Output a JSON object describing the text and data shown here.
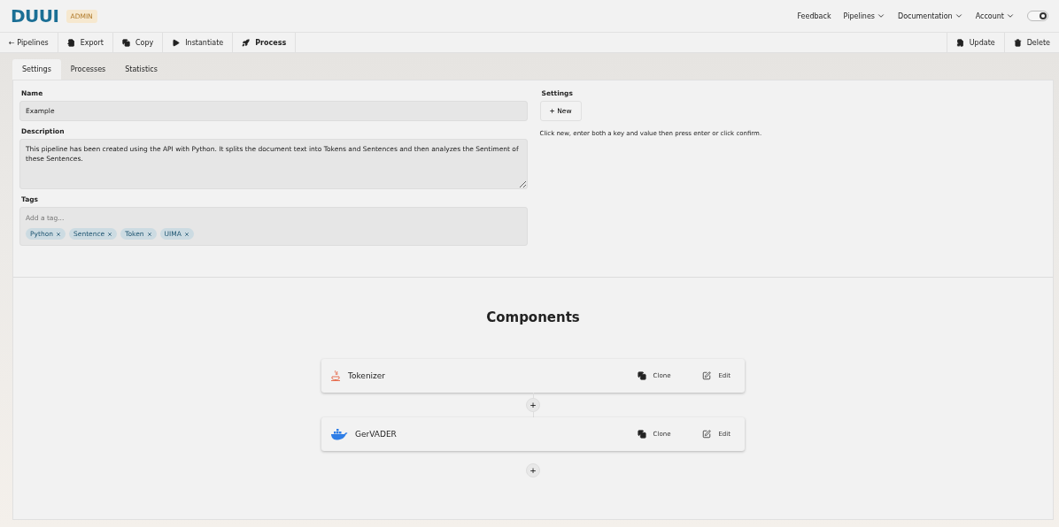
{
  "header": {
    "logo": "DUUI",
    "badge": "ADMIN",
    "nav": [
      {
        "label": "Feedback",
        "dropdown": false
      },
      {
        "label": "Pipelines",
        "dropdown": true
      },
      {
        "label": "Documentation",
        "dropdown": true
      },
      {
        "label": "Account",
        "dropdown": true
      }
    ],
    "theme_toggle": {
      "on": true
    }
  },
  "toolbar": {
    "left": [
      {
        "label": "← Pipelines",
        "bold": false
      },
      {
        "label": "Export",
        "bold": false
      },
      {
        "label": "Copy",
        "bold": false
      },
      {
        "label": "Instantiate",
        "bold": false
      },
      {
        "label": "Process",
        "bold": true
      }
    ],
    "right": [
      {
        "label": "Update"
      },
      {
        "label": "Delete"
      }
    ]
  },
  "tabs": [
    {
      "label": "Settings",
      "selected": true
    },
    {
      "label": "Processes",
      "selected": false
    },
    {
      "label": "Statistics",
      "selected": false
    }
  ],
  "form": {
    "name_label": "Name",
    "name_value": "Example",
    "description_label": "Description",
    "description_value": "This pipeline has been created using the API with Python. It splits the document text into Tokens and Sentences and then analyzes the Sentiment of these Sentences.",
    "tags_label": "Tags",
    "tags_placeholder": "Add a tag...",
    "tags": [
      "Python",
      "Sentence",
      "Token",
      "UIMA"
    ]
  },
  "settings": {
    "label": "Settings",
    "new_button": "+ New",
    "hint": "Click new, enter both a key and value then press enter or click confirm."
  },
  "components": {
    "title": "Components",
    "items": [
      {
        "name": "Tokenizer",
        "kind": "java",
        "clone": "Clone",
        "edit": "Edit"
      },
      {
        "name": "GerVADER",
        "kind": "docker",
        "clone": "Clone",
        "edit": "Edit"
      }
    ],
    "add": [
      "+",
      "+"
    ]
  }
}
